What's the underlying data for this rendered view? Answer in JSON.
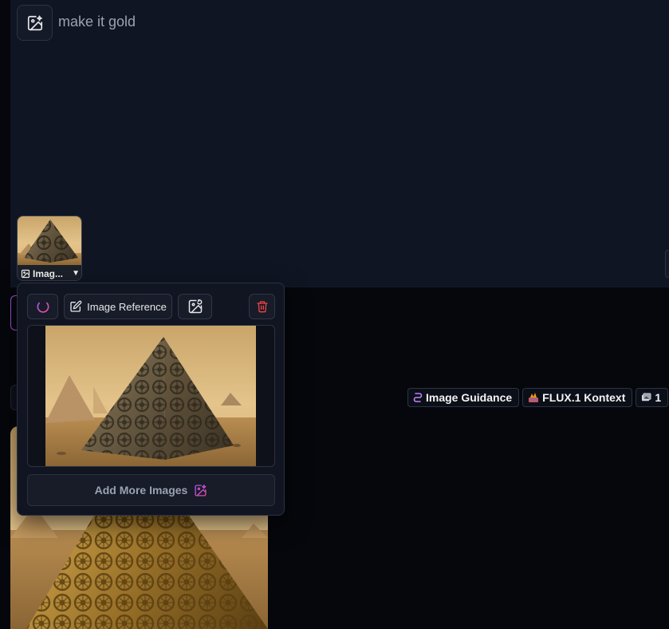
{
  "prompt": {
    "text": "make it gold",
    "add_image_icon": "image-plus-icon"
  },
  "attached_image": {
    "label": "Imag...",
    "type_icon": "image-icon",
    "dropdown_icon": "caret-down-icon"
  },
  "popover": {
    "power_icon": "power-icon",
    "reference_label": "Image Reference",
    "reference_icon": "edit-icon",
    "regenerate_icon": "image-refresh-icon",
    "delete_icon": "trash-icon",
    "add_more_label": "Add More Images",
    "add_more_icon": "image-sparkle-icon"
  },
  "tags": [
    {
      "label": "Image Guidance",
      "icon": "guidance-icon"
    },
    {
      "label": "FLUX.1 Kontext",
      "icon": "flux-logo-icon"
    },
    {
      "label": "1",
      "icon": "image-count-icon"
    }
  ],
  "colors": {
    "panel_bg": "#101523",
    "page_bg": "#05070c",
    "accent_purple": "#a855f7",
    "accent_pink": "#ec4899",
    "delete_red": "#ef4444",
    "gold": "#c9a24a"
  }
}
